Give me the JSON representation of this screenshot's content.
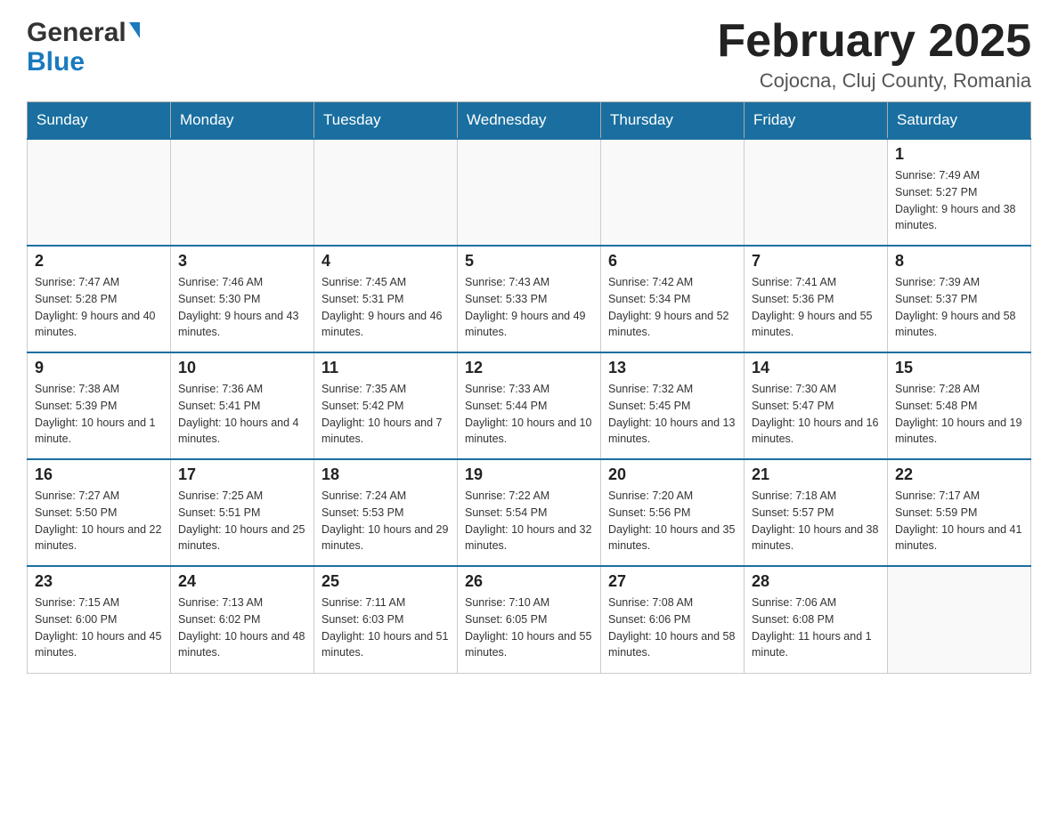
{
  "header": {
    "logo_general": "General",
    "logo_blue": "Blue",
    "title": "February 2025",
    "subtitle": "Cojocna, Cluj County, Romania"
  },
  "days_of_week": [
    "Sunday",
    "Monday",
    "Tuesday",
    "Wednesday",
    "Thursday",
    "Friday",
    "Saturday"
  ],
  "weeks": [
    [
      {
        "day": "",
        "info": ""
      },
      {
        "day": "",
        "info": ""
      },
      {
        "day": "",
        "info": ""
      },
      {
        "day": "",
        "info": ""
      },
      {
        "day": "",
        "info": ""
      },
      {
        "day": "",
        "info": ""
      },
      {
        "day": "1",
        "info": "Sunrise: 7:49 AM\nSunset: 5:27 PM\nDaylight: 9 hours and 38 minutes."
      }
    ],
    [
      {
        "day": "2",
        "info": "Sunrise: 7:47 AM\nSunset: 5:28 PM\nDaylight: 9 hours and 40 minutes."
      },
      {
        "day": "3",
        "info": "Sunrise: 7:46 AM\nSunset: 5:30 PM\nDaylight: 9 hours and 43 minutes."
      },
      {
        "day": "4",
        "info": "Sunrise: 7:45 AM\nSunset: 5:31 PM\nDaylight: 9 hours and 46 minutes."
      },
      {
        "day": "5",
        "info": "Sunrise: 7:43 AM\nSunset: 5:33 PM\nDaylight: 9 hours and 49 minutes."
      },
      {
        "day": "6",
        "info": "Sunrise: 7:42 AM\nSunset: 5:34 PM\nDaylight: 9 hours and 52 minutes."
      },
      {
        "day": "7",
        "info": "Sunrise: 7:41 AM\nSunset: 5:36 PM\nDaylight: 9 hours and 55 minutes."
      },
      {
        "day": "8",
        "info": "Sunrise: 7:39 AM\nSunset: 5:37 PM\nDaylight: 9 hours and 58 minutes."
      }
    ],
    [
      {
        "day": "9",
        "info": "Sunrise: 7:38 AM\nSunset: 5:39 PM\nDaylight: 10 hours and 1 minute."
      },
      {
        "day": "10",
        "info": "Sunrise: 7:36 AM\nSunset: 5:41 PM\nDaylight: 10 hours and 4 minutes."
      },
      {
        "day": "11",
        "info": "Sunrise: 7:35 AM\nSunset: 5:42 PM\nDaylight: 10 hours and 7 minutes."
      },
      {
        "day": "12",
        "info": "Sunrise: 7:33 AM\nSunset: 5:44 PM\nDaylight: 10 hours and 10 minutes."
      },
      {
        "day": "13",
        "info": "Sunrise: 7:32 AM\nSunset: 5:45 PM\nDaylight: 10 hours and 13 minutes."
      },
      {
        "day": "14",
        "info": "Sunrise: 7:30 AM\nSunset: 5:47 PM\nDaylight: 10 hours and 16 minutes."
      },
      {
        "day": "15",
        "info": "Sunrise: 7:28 AM\nSunset: 5:48 PM\nDaylight: 10 hours and 19 minutes."
      }
    ],
    [
      {
        "day": "16",
        "info": "Sunrise: 7:27 AM\nSunset: 5:50 PM\nDaylight: 10 hours and 22 minutes."
      },
      {
        "day": "17",
        "info": "Sunrise: 7:25 AM\nSunset: 5:51 PM\nDaylight: 10 hours and 25 minutes."
      },
      {
        "day": "18",
        "info": "Sunrise: 7:24 AM\nSunset: 5:53 PM\nDaylight: 10 hours and 29 minutes."
      },
      {
        "day": "19",
        "info": "Sunrise: 7:22 AM\nSunset: 5:54 PM\nDaylight: 10 hours and 32 minutes."
      },
      {
        "day": "20",
        "info": "Sunrise: 7:20 AM\nSunset: 5:56 PM\nDaylight: 10 hours and 35 minutes."
      },
      {
        "day": "21",
        "info": "Sunrise: 7:18 AM\nSunset: 5:57 PM\nDaylight: 10 hours and 38 minutes."
      },
      {
        "day": "22",
        "info": "Sunrise: 7:17 AM\nSunset: 5:59 PM\nDaylight: 10 hours and 41 minutes."
      }
    ],
    [
      {
        "day": "23",
        "info": "Sunrise: 7:15 AM\nSunset: 6:00 PM\nDaylight: 10 hours and 45 minutes."
      },
      {
        "day": "24",
        "info": "Sunrise: 7:13 AM\nSunset: 6:02 PM\nDaylight: 10 hours and 48 minutes."
      },
      {
        "day": "25",
        "info": "Sunrise: 7:11 AM\nSunset: 6:03 PM\nDaylight: 10 hours and 51 minutes."
      },
      {
        "day": "26",
        "info": "Sunrise: 7:10 AM\nSunset: 6:05 PM\nDaylight: 10 hours and 55 minutes."
      },
      {
        "day": "27",
        "info": "Sunrise: 7:08 AM\nSunset: 6:06 PM\nDaylight: 10 hours and 58 minutes."
      },
      {
        "day": "28",
        "info": "Sunrise: 7:06 AM\nSunset: 6:08 PM\nDaylight: 11 hours and 1 minute."
      },
      {
        "day": "",
        "info": ""
      }
    ]
  ]
}
